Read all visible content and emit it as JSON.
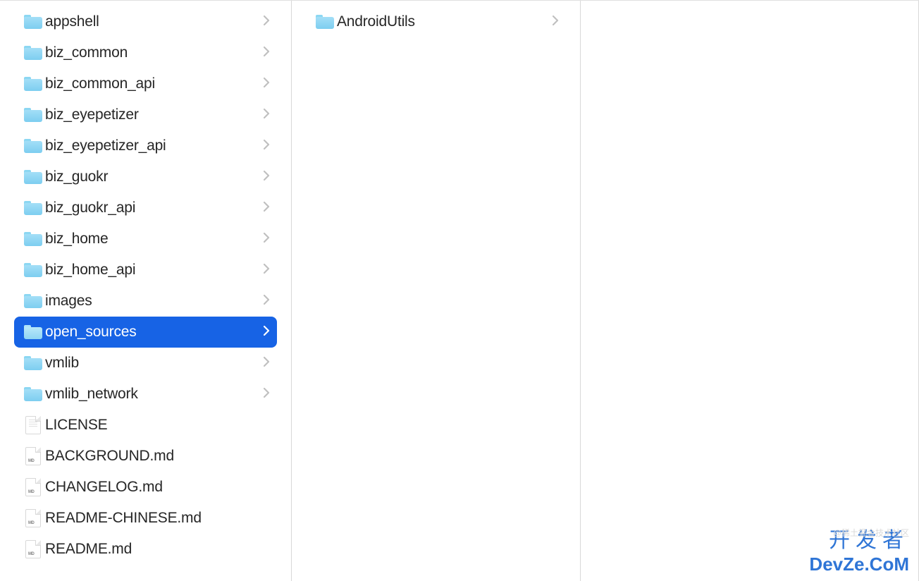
{
  "columns": [
    {
      "items": [
        {
          "name": "appshell",
          "type": "folder",
          "hasChildren": true,
          "selected": false
        },
        {
          "name": "biz_common",
          "type": "folder",
          "hasChildren": true,
          "selected": false
        },
        {
          "name": "biz_common_api",
          "type": "folder",
          "hasChildren": true,
          "selected": false
        },
        {
          "name": "biz_eyepetizer",
          "type": "folder",
          "hasChildren": true,
          "selected": false
        },
        {
          "name": "biz_eyepetizer_api",
          "type": "folder",
          "hasChildren": true,
          "selected": false
        },
        {
          "name": "biz_guokr",
          "type": "folder",
          "hasChildren": true,
          "selected": false
        },
        {
          "name": "biz_guokr_api",
          "type": "folder",
          "hasChildren": true,
          "selected": false
        },
        {
          "name": "biz_home",
          "type": "folder",
          "hasChildren": true,
          "selected": false
        },
        {
          "name": "biz_home_api",
          "type": "folder",
          "hasChildren": true,
          "selected": false
        },
        {
          "name": "images",
          "type": "folder",
          "hasChildren": true,
          "selected": false
        },
        {
          "name": "open_sources",
          "type": "folder",
          "hasChildren": true,
          "selected": true
        },
        {
          "name": "vmlib",
          "type": "folder",
          "hasChildren": true,
          "selected": false
        },
        {
          "name": "vmlib_network",
          "type": "folder",
          "hasChildren": true,
          "selected": false
        },
        {
          "name": "LICENSE",
          "type": "file",
          "hasChildren": false,
          "selected": false
        },
        {
          "name": "BACKGROUND.md",
          "type": "mdfile",
          "hasChildren": false,
          "selected": false
        },
        {
          "name": "CHANGELOG.md",
          "type": "mdfile",
          "hasChildren": false,
          "selected": false
        },
        {
          "name": "README-CHINESE.md",
          "type": "mdfile",
          "hasChildren": false,
          "selected": false
        },
        {
          "name": "README.md",
          "type": "mdfile",
          "hasChildren": false,
          "selected": false
        }
      ]
    },
    {
      "items": [
        {
          "name": "AndroidUtils",
          "type": "folder",
          "hasChildren": true,
          "selected": false
        }
      ]
    }
  ],
  "watermark": {
    "faint": "@稀土掘金技术社区",
    "line1": "开发者",
    "line2": "DevZe.CoM"
  }
}
